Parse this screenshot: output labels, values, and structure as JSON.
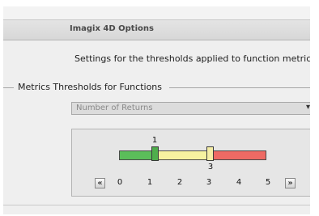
{
  "window": {
    "title": "Imagix 4D Options"
  },
  "main": {
    "description": "Settings for the thresholds applied to function metrics",
    "group_label": "Metrics Thresholds for Functions",
    "metric_select": {
      "selected": "Number of Returns",
      "arrow_icon": "chevron-down-icon"
    }
  },
  "threshold_slider": {
    "low_value": "1",
    "high_value": "3",
    "scale": [
      "0",
      "1",
      "2",
      "3",
      "4",
      "5"
    ],
    "range_min": 0,
    "range_max": 5,
    "low_threshold": 1,
    "high_threshold": 3,
    "prev_icon": "double-chevron-left-icon",
    "next_icon": "double-chevron-right-icon",
    "prev_glyph": "«",
    "next_glyph": "»",
    "colors": {
      "low": "#5bbd5a",
      "mid": "#f6f2a0",
      "high": "#ee6a64"
    }
  }
}
